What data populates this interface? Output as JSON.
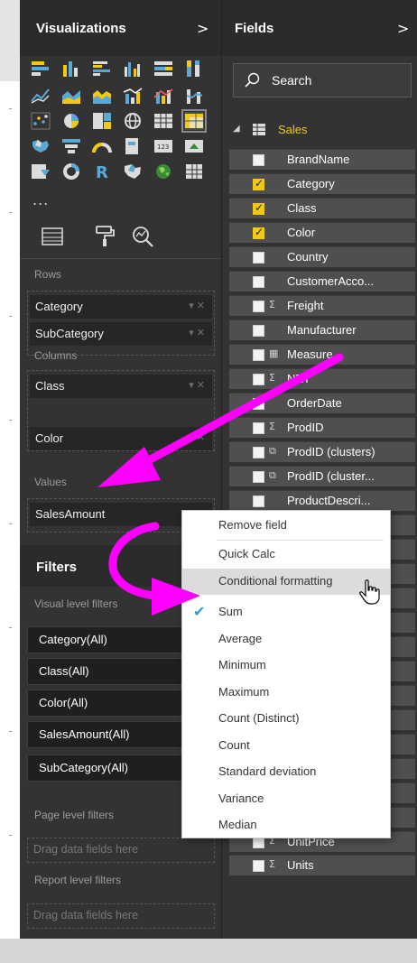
{
  "visualizations": {
    "title": "Visualizations",
    "expand_glyph": ">",
    "more": "...",
    "selected_visual": "matrix"
  },
  "wells": {
    "rows_label": "Rows",
    "rows": [
      "Category",
      "SubCategory"
    ],
    "columns_label": "Columns",
    "columns": [
      "Class",
      "Color"
    ],
    "values_label": "Values",
    "values": [
      "SalesAmount"
    ]
  },
  "filters": {
    "title": "Filters",
    "visual_level_label": "Visual level filters",
    "visual_filters": [
      "Category(All)",
      "Class(All)",
      "Color(All)",
      "SalesAmount(All)",
      "SubCategory(All)"
    ],
    "page_level_label": "Page level filters",
    "page_drop": "Drag data fields here",
    "report_level_label": "Report level filters",
    "report_drop": "Drag data fields here"
  },
  "fields": {
    "title": "Fields",
    "expand_glyph": ">",
    "search_placeholder": "Search",
    "table_name": "Sales",
    "items": [
      {
        "name": "BrandName",
        "checked": false,
        "type": ""
      },
      {
        "name": "Category",
        "checked": true,
        "type": ""
      },
      {
        "name": "Class",
        "checked": true,
        "type": ""
      },
      {
        "name": "Color",
        "checked": true,
        "type": ""
      },
      {
        "name": "Country",
        "checked": false,
        "type": ""
      },
      {
        "name": "CustomerAcco...",
        "checked": false,
        "type": ""
      },
      {
        "name": "Freight",
        "checked": false,
        "type": "sigma"
      },
      {
        "name": "Manufacturer",
        "checked": false,
        "type": ""
      },
      {
        "name": "Measure",
        "checked": false,
        "type": "calc"
      },
      {
        "name": "NET",
        "checked": false,
        "type": "sigma"
      },
      {
        "name": "OrderDate",
        "checked": false,
        "type": ""
      },
      {
        "name": "ProdID",
        "checked": false,
        "type": "sigma"
      },
      {
        "name": "ProdID (clusters)",
        "checked": false,
        "type": "group"
      },
      {
        "name": "ProdID (cluster...",
        "checked": false,
        "type": "group"
      },
      {
        "name": "ProductDescri...",
        "checked": false,
        "type": ""
      },
      {
        "name": "UnitPrice",
        "checked": false,
        "type": "sigma"
      },
      {
        "name": "Units",
        "checked": false,
        "type": "sigma"
      }
    ]
  },
  "context_menu": {
    "items": [
      {
        "label": "Remove field",
        "checked": false
      },
      {
        "label": "Quick Calc",
        "checked": false
      },
      {
        "label": "Conditional formatting",
        "checked": false,
        "hover": true
      },
      {
        "label": "Sum",
        "checked": true
      },
      {
        "label": "Average",
        "checked": false
      },
      {
        "label": "Minimum",
        "checked": false
      },
      {
        "label": "Maximum",
        "checked": false
      },
      {
        "label": "Count (Distinct)",
        "checked": false
      },
      {
        "label": "Count",
        "checked": false
      },
      {
        "label": "Standard deviation",
        "checked": false
      },
      {
        "label": "Variance",
        "checked": false
      },
      {
        "label": "Median",
        "checked": false
      }
    ]
  },
  "colors": {
    "pane_bg": "#333333",
    "accent_yellow": "#f2c811",
    "annotation_magenta": "#ff00ff",
    "check_blue": "#2e9fd1"
  }
}
